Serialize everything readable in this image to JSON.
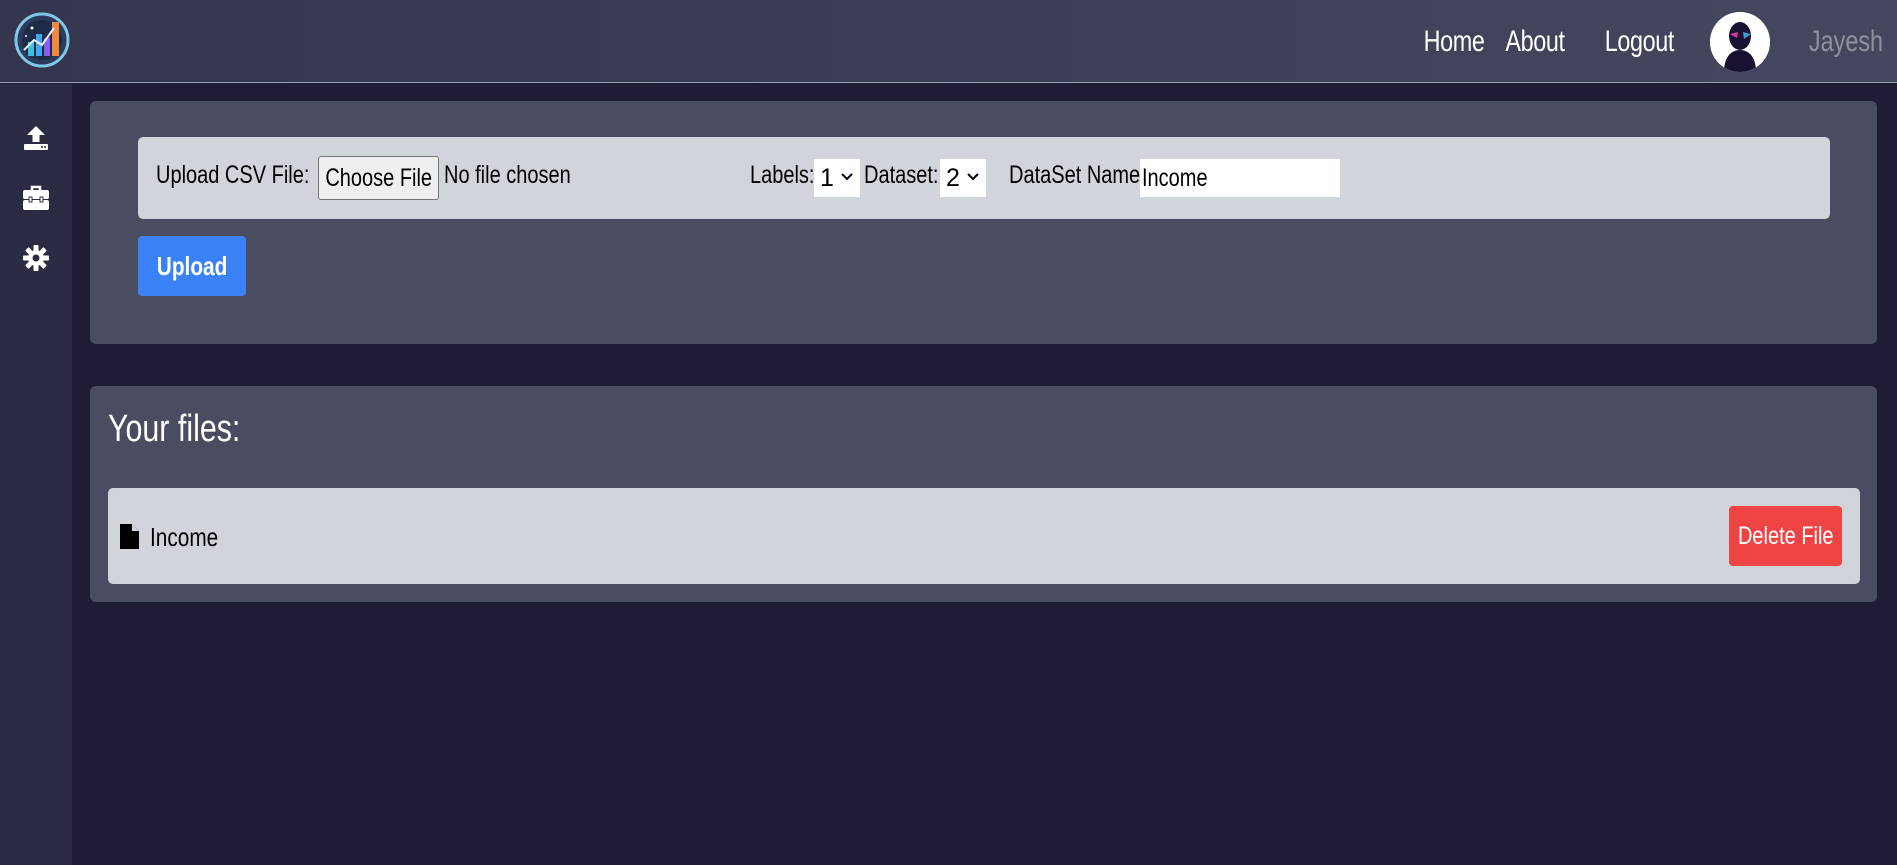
{
  "nav": {
    "links": [
      "Home",
      "About",
      "Logout"
    ],
    "username": "Jayesh"
  },
  "sidebar": {
    "icons": [
      "upload-icon",
      "toolbox-icon",
      "gear-icon"
    ]
  },
  "upload_form": {
    "csv_label": "Upload CSV File:",
    "choose_file_label": "Choose File",
    "no_file_text": "No file chosen",
    "labels_label": "Labels:",
    "labels_value": "1",
    "dataset_label": "Dataset:",
    "dataset_value": "2",
    "dataset_name_label": "DataSet Name:",
    "dataset_name_value": "Income",
    "upload_button": "Upload"
  },
  "files": {
    "title": "Your files:",
    "items": [
      {
        "name": "Income",
        "delete_label": "Delete File"
      }
    ]
  },
  "colors": {
    "primary": "#3b82f6",
    "danger": "#ef4444",
    "panel": "#4a4d61",
    "background": "#1f1d35"
  }
}
